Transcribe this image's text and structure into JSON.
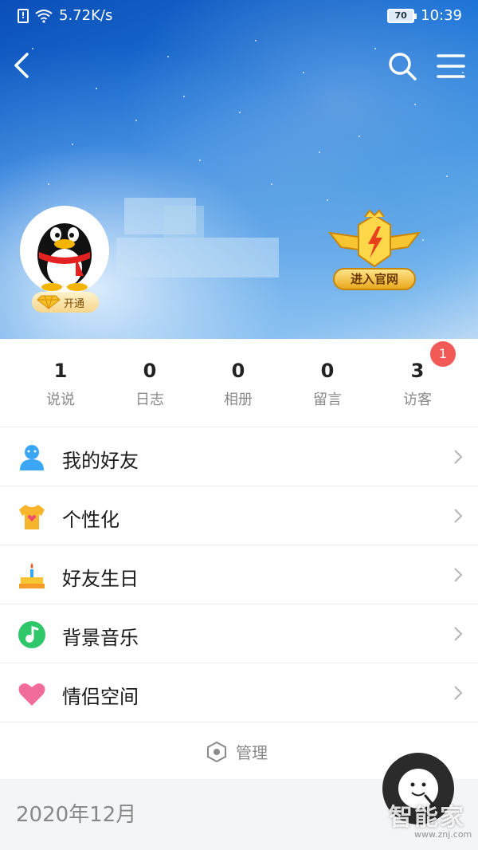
{
  "status_bar": {
    "network_speed": "5.72K/s",
    "battery": "70",
    "time": "10:39"
  },
  "profile": {
    "vip_badge_label": "开通",
    "official_site_label": "进入官网"
  },
  "stats": [
    {
      "count": "1",
      "label": "说说"
    },
    {
      "count": "0",
      "label": "日志"
    },
    {
      "count": "0",
      "label": "相册"
    },
    {
      "count": "0",
      "label": "留言"
    },
    {
      "count": "3",
      "label": "访客"
    }
  ],
  "visitor_badge": "1",
  "menu": [
    {
      "label": "我的好友",
      "icon": "friends-icon",
      "color": "#3aa6f5"
    },
    {
      "label": "个性化",
      "icon": "tshirt-icon",
      "color": "#f7b52c"
    },
    {
      "label": "好友生日",
      "icon": "birthday-cake-icon",
      "color": "#f59b2a"
    },
    {
      "label": "背景音乐",
      "icon": "music-note-icon",
      "color": "#2ec76a"
    },
    {
      "label": "情侣空间",
      "icon": "heart-icon",
      "color": "#f26b9d"
    }
  ],
  "manage": {
    "label": "管理"
  },
  "timeline": {
    "date_label": "2020年12月"
  },
  "watermark": {
    "text": "智能家",
    "sub": "www.znj.com"
  }
}
